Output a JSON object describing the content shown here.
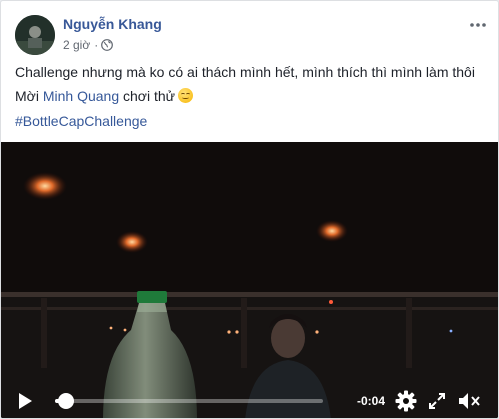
{
  "post": {
    "author": "Nguyễn Khang",
    "time": "2 giờ",
    "separator": "·",
    "privacy_icon": "globe-icon",
    "more_icon": "more-dots-icon",
    "text_line1": "Challenge nhưng mà ko có ai thách mình hết, mình thích thì mình làm thôi",
    "invite_prefix": "Mời ",
    "mention": "Minh Quang",
    "invite_suffix": " chơi thử",
    "emoji": "smiling-face-emoji",
    "hashtag": "#BottleCapChallenge"
  },
  "video": {
    "time_remaining": "-0:04",
    "progress": 0.02,
    "play_icon": "play-icon",
    "settings_icon": "gear-icon",
    "fullscreen_icon": "expand-icon",
    "mute_icon": "speaker-muted-icon"
  }
}
